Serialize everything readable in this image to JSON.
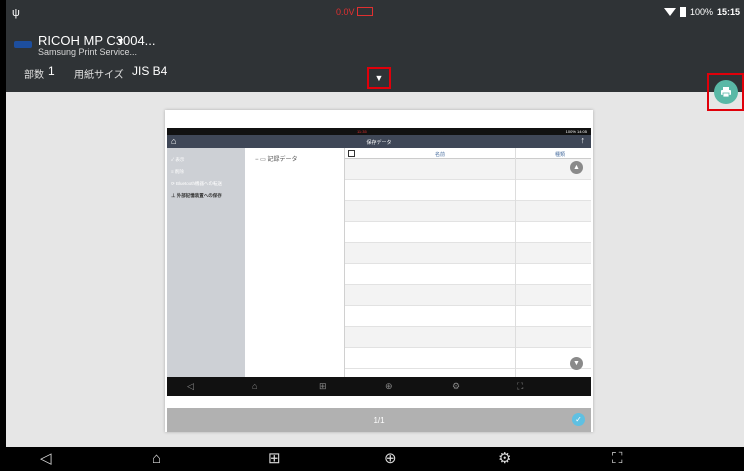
{
  "status_bar": {
    "usb_icon": "usb-icon",
    "voltage": "0.0V",
    "battery_percent": "100%",
    "time": "15:15"
  },
  "header": {
    "printer_name": "RICOH MP C3004...",
    "printer_service": "Samsung Print Service...",
    "copies_label": "部数",
    "copies_value": "1",
    "paper_label": "用紙サイズ",
    "paper_value": "JIS B4",
    "expand_icon": "chevron-down-icon",
    "print_icon": "print-icon",
    "accent_color": "#59b8a6",
    "highlight_color": "#e0000a"
  },
  "preview": {
    "status_time": "11:35",
    "status_right": "100% 14:05",
    "title": "保存データ",
    "side_items": [
      {
        "label": "✓ 表示",
        "active": false
      },
      {
        "label": "≡ 削除",
        "active": false
      },
      {
        "label": "⟳ Bluetooth機器への転送",
        "active": false
      },
      {
        "label": "⊥ 外部記憶装置への保存",
        "active": true
      }
    ],
    "tree_node": "記録データ",
    "col_name": "名前",
    "col_type": "種類",
    "page_indicator": "1/1"
  }
}
